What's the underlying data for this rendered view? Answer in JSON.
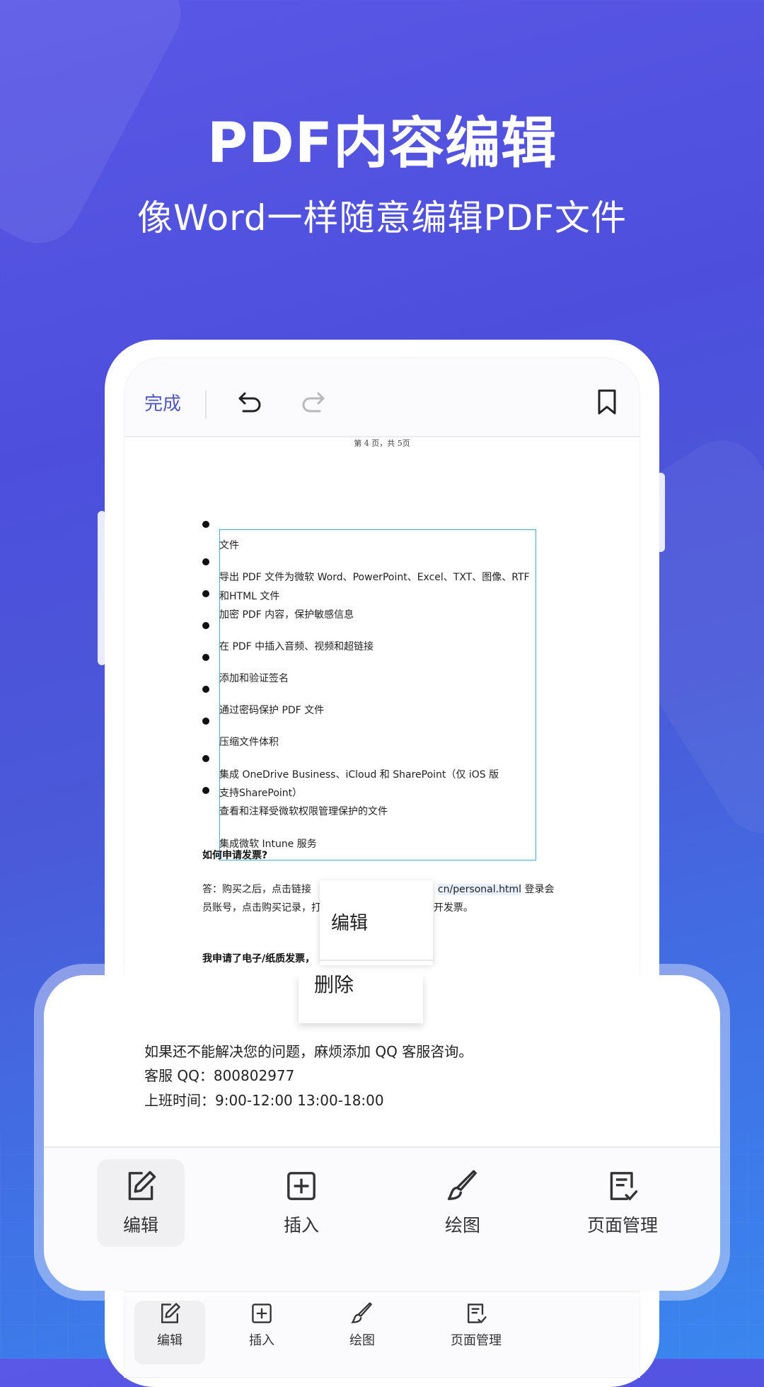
{
  "headline": "PDF内容编辑",
  "subline": "像Word一样随意编辑PDF文件",
  "topbar": {
    "done_label": "完成"
  },
  "page_indicator": "第 4 页，共 5页",
  "doc_lines": [
    "文件",
    "导出 PDF 文件为微软 Word、PowerPoint、Excel、TXT、图像、RTF",
    "和HTML 文件",
    "加密 PDF 内容，保护敏感信息",
    "在 PDF 中插入音频、视频和超链接",
    "添加和验证签名",
    "通过密码保护 PDF 文件",
    "压缩文件体积",
    "集成 OneDrive Business、iCloud 和 SharePoint（仅 iOS 版",
    "支持SharePoint）",
    "查看和注释受微软权限管理保护的文件",
    "集成微软 Intune 服务"
  ],
  "faq": {
    "q1": "如何申请发票?",
    "a1_prefix": "答：购买之后，点击链接",
    "a1_link": "cn/personal.html",
    "a1_suffix": "登录会",
    "a1_line2_prefix": "员账号，点击购买记录，打",
    "a1_line2_suffix": "请开发票。",
    "q2": "我申请了电子/纸质发票，"
  },
  "context_menu": {
    "edit": "编辑",
    "delete": "删除"
  },
  "contact": {
    "line1": "如果还不能解决您的问题，麻烦添加 QQ 客服咨询。",
    "line2": "客服 QQ：800802977",
    "line3": "上班时间：9:00-12:00    13:00-18:00"
  },
  "toolbar": {
    "edit": "编辑",
    "insert": "插入",
    "draw": "绘图",
    "page_manage": "页面管理"
  },
  "colors": {
    "accent": "#5057c4",
    "selection": "#3cb0d0"
  }
}
